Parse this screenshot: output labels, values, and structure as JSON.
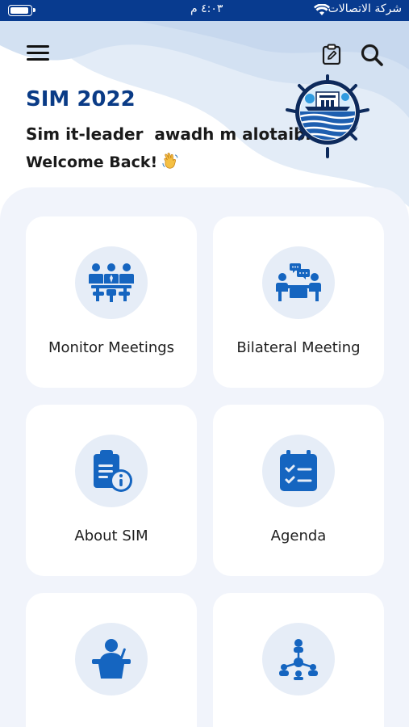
{
  "status_bar": {
    "carrier": "شركة الاتصالات",
    "time": "٤:٠٣ م"
  },
  "header": {
    "app_title": "SIM 2022",
    "user_name": "Sim it-leader  awadh m alotaibi",
    "welcome": "Welcome Back!"
  },
  "icons": {
    "menu": "hamburger-menu-icon",
    "clipboard": "clipboard-edit-icon",
    "search": "search-icon",
    "logo": "ship-wheel-logo"
  },
  "cards": [
    {
      "label": "Monitor Meetings",
      "icon": "meeting-group-icon"
    },
    {
      "label": "Bilateral Meeting",
      "icon": "bilateral-talk-icon"
    },
    {
      "label": "About SIM",
      "icon": "clipboard-info-icon"
    },
    {
      "label": "Agenda",
      "icon": "calendar-checklist-icon"
    },
    {
      "label": "",
      "icon": "speaker-podium-icon"
    },
    {
      "label": "",
      "icon": "network-hierarchy-icon"
    }
  ],
  "colors": {
    "primary": "#0a3b86",
    "icon_blue": "#1565c0",
    "icon_bg": "#e6edf7",
    "panel_bg": "#f1f4fb",
    "status_bar": "#083b8f"
  }
}
